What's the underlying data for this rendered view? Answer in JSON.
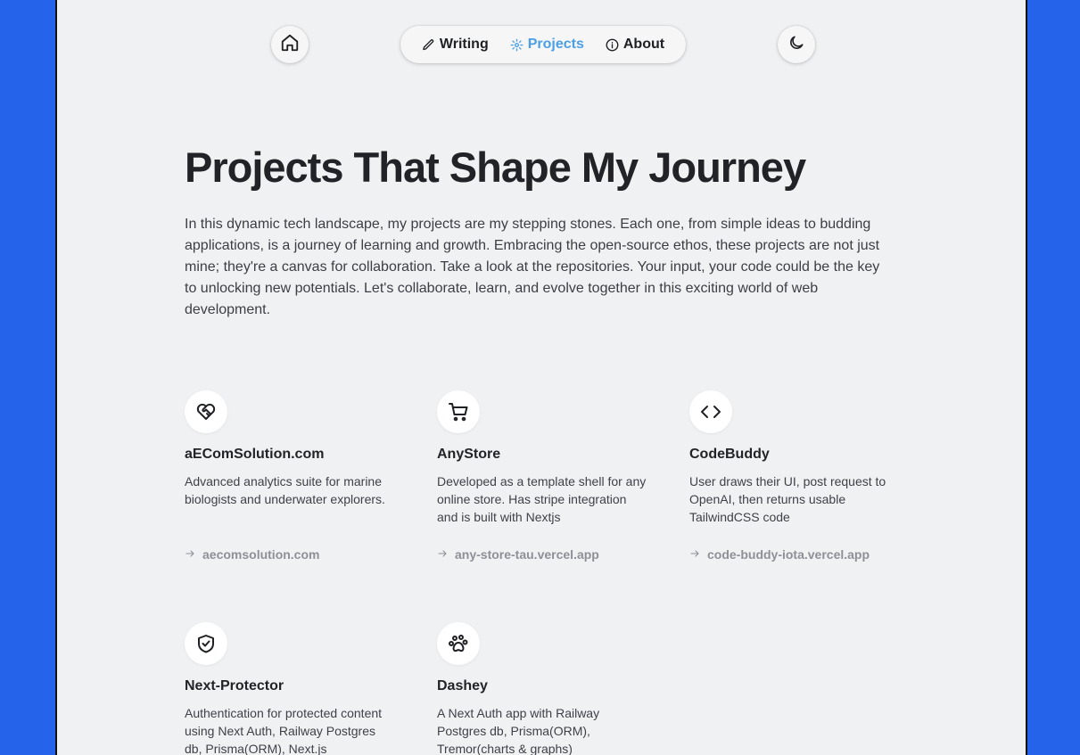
{
  "nav": {
    "items": [
      {
        "label": "Writing",
        "icon": "pencil-icon"
      },
      {
        "label": "Projects",
        "icon": "gear-icon",
        "active": true
      },
      {
        "label": "About",
        "icon": "info-icon"
      }
    ]
  },
  "hero": {
    "title": "Projects That Shape My Journey",
    "text": "In this dynamic tech landscape, my projects are my stepping stones. Each one, from simple ideas to budding applications, is a journey of learning and growth. Embracing the open-source ethos, these projects are not just mine; they're a canvas for collaboration. Take a look at the repositories. Your input, your code could be the key to unlocking new potentials. Let's collaborate, learn, and evolve together in this exciting world of web development."
  },
  "projects": [
    {
      "name": "aEComSolution.com",
      "icon": "heart-handshake-icon",
      "description": "Advanced analytics suite for marine biologists and underwater explorers.",
      "link": "aecomsolution.com"
    },
    {
      "name": "AnyStore",
      "icon": "shopping-cart-icon",
      "description": "Developed as a template shell for any online store. Has stripe integration and is built with Nextjs",
      "link": "any-store-tau.vercel.app"
    },
    {
      "name": "CodeBuddy",
      "icon": "code-icon",
      "description": "User draws their UI, post request to OpenAI, then returns usable TailwindCSS code",
      "link": "code-buddy-iota.vercel.app"
    },
    {
      "name": "Next-Protector",
      "icon": "shield-check-icon",
      "description": "Authentication for protected content using Next Auth, Railway Postgres db, Prisma(ORM), Next.js",
      "link": ""
    },
    {
      "name": "Dashey",
      "icon": "paw-icon",
      "description": "A Next Auth app with Railway Postgres db, Prisma(ORM), Tremor(charts & graphs)",
      "link": ""
    }
  ],
  "colors": {
    "background": "#2563eb",
    "page": "#f0f1f3",
    "active_nav": "#4a9fe6",
    "text": "#222326",
    "muted": "#8e9096"
  }
}
